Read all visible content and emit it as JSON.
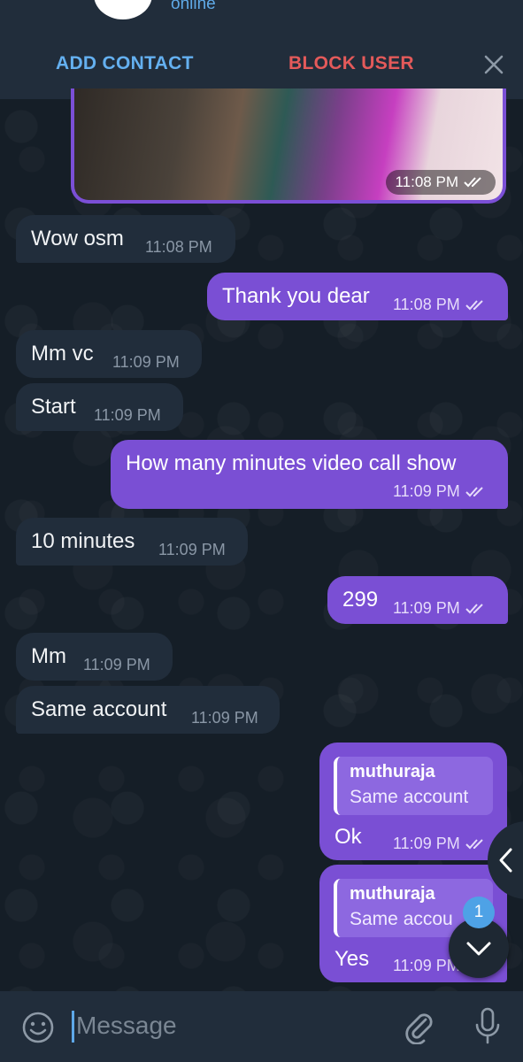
{
  "header": {
    "status": "online",
    "add_contact": "ADD CONTACT",
    "block_user": "BLOCK USER"
  },
  "photo_message": {
    "time": "11:08 PM"
  },
  "messages": [
    {
      "dir": "in",
      "text": "Wow osm",
      "time": "11:08 PM"
    },
    {
      "dir": "out",
      "text": "Thank you dear",
      "time": "11:08 PM"
    },
    {
      "dir": "in",
      "text": "Mm vc",
      "time": "11:09 PM"
    },
    {
      "dir": "in",
      "text": "Start",
      "time": "11:09 PM"
    },
    {
      "dir": "out",
      "text": "How many minutes video call show",
      "time": "11:09 PM"
    },
    {
      "dir": "in",
      "text": "10 minutes",
      "time": "11:09 PM"
    },
    {
      "dir": "out",
      "text": "299",
      "time": "11:09 PM"
    },
    {
      "dir": "in",
      "text": "Mm",
      "time": "11:09 PM"
    },
    {
      "dir": "in",
      "text": "Same account",
      "time": "11:09 PM"
    },
    {
      "dir": "out",
      "text": "Ok",
      "time": "11:09 PM",
      "reply_name": "muthuraja",
      "reply_text": "Same account"
    },
    {
      "dir": "out",
      "text": "Yes",
      "time": "11:09 PM",
      "reply_name": "muthuraja",
      "reply_text": "Same accou"
    }
  ],
  "unread_badge": "1",
  "composer": {
    "placeholder": "Message"
  },
  "colors": {
    "incoming_bubble": "#212d3b",
    "outgoing_bubble": "#7a4fd4",
    "accent_blue": "#64b0f0",
    "danger_red": "#e45a5a"
  }
}
